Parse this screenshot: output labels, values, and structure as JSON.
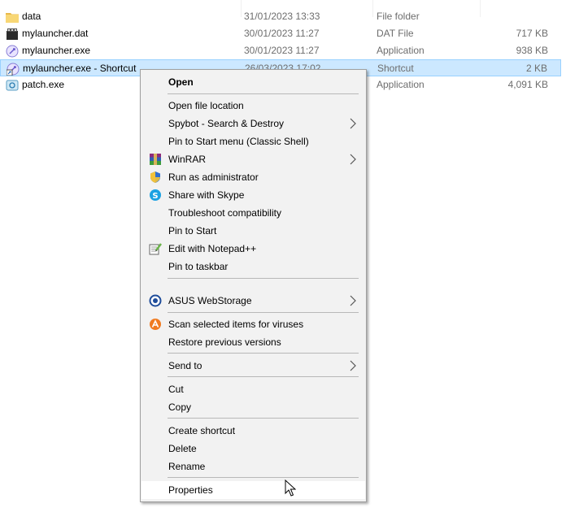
{
  "files": [
    {
      "name": "data",
      "date": "31/01/2023 13:33",
      "type": "File folder",
      "size": "",
      "icon": "folder-icon"
    },
    {
      "name": "mylauncher.dat",
      "date": "30/01/2023 11:27",
      "type": "DAT File",
      "size": "717 KB",
      "icon": "dat-file-icon"
    },
    {
      "name": "mylauncher.exe",
      "date": "30/01/2023 11:27",
      "type": "Application",
      "size": "938 KB",
      "icon": "launcher-app-icon"
    },
    {
      "name": "mylauncher.exe - Shortcut",
      "date": "26/03/2023 17:02",
      "type": "Shortcut",
      "size": "2 KB",
      "icon": "shortcut-icon",
      "selected": true
    },
    {
      "name": "patch.exe",
      "date": "",
      "type": "Application",
      "size": "4,091 KB",
      "icon": "patch-app-icon"
    }
  ],
  "context_menu": {
    "open": "Open",
    "open_file_location": "Open file location",
    "spybot": "Spybot - Search & Destroy",
    "pin_start_classic": "Pin to Start menu (Classic Shell)",
    "winrar": "WinRAR",
    "run_as_admin": "Run as administrator",
    "share_skype": "Share with Skype",
    "troubleshoot": "Troubleshoot compatibility",
    "pin_start": "Pin to Start",
    "edit_notepad": "Edit with Notepad++",
    "pin_taskbar": "Pin to taskbar",
    "asus_webstorage": "ASUS WebStorage",
    "scan_viruses": "Scan selected items for viruses",
    "restore_versions": "Restore previous versions",
    "send_to": "Send to",
    "cut": "Cut",
    "copy": "Copy",
    "create_shortcut": "Create shortcut",
    "delete": "Delete",
    "rename": "Rename",
    "properties": "Properties"
  },
  "colors": {
    "selection_bg": "#cce8ff",
    "selection_border": "#99d1ff",
    "menu_bg": "#f2f2f2",
    "menu_hover": "#ffffff",
    "secondary_text": "#6d6d6d"
  }
}
